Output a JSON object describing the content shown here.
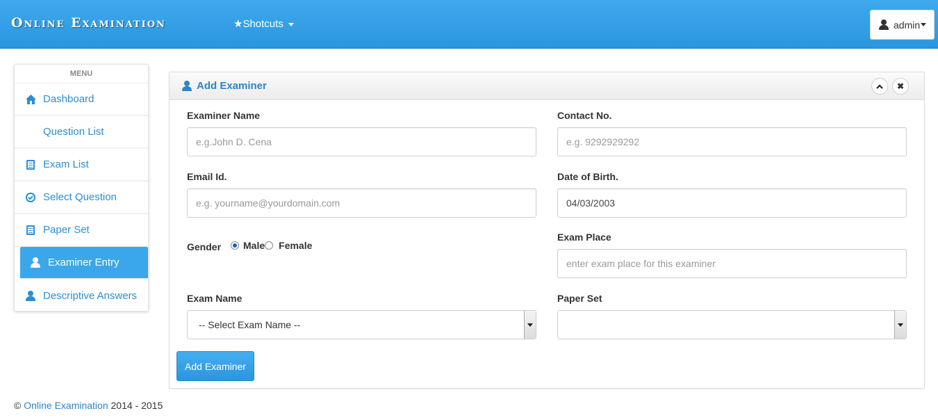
{
  "navbar": {
    "brand": "Online Examination",
    "shortcuts_label": "Shotcuts",
    "user_label": "admin"
  },
  "sidebar": {
    "title": "MENU",
    "items": [
      {
        "label": "Dashboard",
        "icon": "home-icon"
      },
      {
        "label": "Question List",
        "icon": "question-circle-icon"
      },
      {
        "label": "Exam List",
        "icon": "list-icon"
      },
      {
        "label": "Select Question",
        "icon": "check-circle-icon"
      },
      {
        "label": "Paper Set",
        "icon": "list-icon"
      },
      {
        "label": "Examiner Entry",
        "icon": "user-icon",
        "active": true
      },
      {
        "label": "Descriptive Answers",
        "icon": "user-icon"
      }
    ]
  },
  "panel": {
    "title": "Add Examiner",
    "fields": {
      "examiner_name": {
        "label": "Examiner Name",
        "placeholder": "e.g.John D. Cena",
        "value": ""
      },
      "contact_no": {
        "label": "Contact No.",
        "placeholder": "e.g. 9292929292",
        "value": ""
      },
      "email": {
        "label": "Email Id.",
        "placeholder": "e.g. yourname@yourdomain.com",
        "value": ""
      },
      "dob": {
        "label": "Date of Birth.",
        "value": "04/03/2003"
      },
      "gender": {
        "label": "Gender",
        "options": [
          "Male",
          "Female"
        ],
        "selected": "Male"
      },
      "exam_place": {
        "label": "Exam Place",
        "placeholder": "enter exam place for this examiner",
        "value": ""
      },
      "exam_name": {
        "label": "Exam Name",
        "selected": "-- Select Exam Name --"
      },
      "paper_set": {
        "label": "Paper Set",
        "selected": ""
      }
    },
    "submit_label": "Add Examiner"
  },
  "footer": {
    "copyright_symbol": "©",
    "link_text": "Online Examination",
    "years": "2014 - 2015"
  },
  "colors": {
    "brand_blue": "#3aa7ea",
    "link_blue": "#2a85c9"
  }
}
